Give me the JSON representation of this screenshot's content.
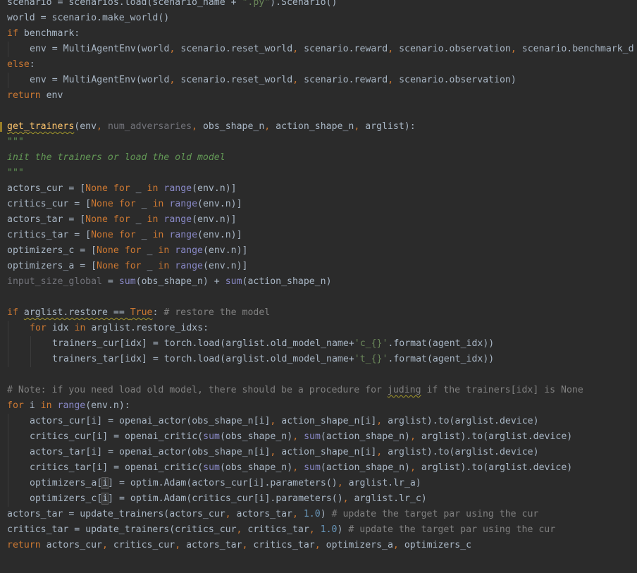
{
  "editor": {
    "colors": {
      "background": "#2b2b2b",
      "default_text": "#a9b7c6",
      "keyword": "#cc7832",
      "string": "#6a8759",
      "number": "#6897bb",
      "builtin": "#8888c6",
      "comment": "#808080",
      "docstring": "#629755",
      "parameter": "#aa4926",
      "unused": "#72737a",
      "warning_underline": "#a59a2a"
    },
    "lines": [
      {
        "indent": 1,
        "tokens": [
          {
            "t": "scenario = scenarios.load(scenario_name + ",
            "k": "n"
          },
          {
            "t": "\".py\"",
            "k": "s"
          },
          {
            "t": ").Scenario()",
            "k": "n"
          }
        ]
      },
      {
        "indent": 1,
        "tokens": [
          {
            "t": "world = scenario.make_world()",
            "k": "n"
          }
        ]
      },
      {
        "indent": 1,
        "tokens": [
          {
            "t": "if",
            "k": "k"
          },
          {
            "t": " benchmark:",
            "k": "n"
          }
        ]
      },
      {
        "indent": 2,
        "tokens": [
          {
            "t": "env = MultiAgentEnv(world",
            "k": "n"
          },
          {
            "t": ",",
            "k": "k"
          },
          {
            "t": " scenario.reset_world",
            "k": "n"
          },
          {
            "t": ",",
            "k": "k"
          },
          {
            "t": " scenario.reward",
            "k": "n"
          },
          {
            "t": ",",
            "k": "k"
          },
          {
            "t": " scenario.observation",
            "k": "n"
          },
          {
            "t": ",",
            "k": "k"
          },
          {
            "t": " scenario.benchmark_d",
            "k": "n"
          }
        ]
      },
      {
        "indent": 1,
        "tokens": [
          {
            "t": "else",
            "k": "k"
          },
          {
            "t": ":",
            "k": "n"
          }
        ]
      },
      {
        "indent": 2,
        "tokens": [
          {
            "t": "env = MultiAgentEnv(world",
            "k": "n"
          },
          {
            "t": ",",
            "k": "k"
          },
          {
            "t": " scenario.reset_world",
            "k": "n"
          },
          {
            "t": ",",
            "k": "k"
          },
          {
            "t": " scenario.reward",
            "k": "n"
          },
          {
            "t": ",",
            "k": "k"
          },
          {
            "t": " scenario.observation)",
            "k": "n"
          }
        ]
      },
      {
        "indent": 1,
        "tokens": [
          {
            "t": "return",
            "k": "k"
          },
          {
            "t": " env",
            "k": "n"
          }
        ]
      },
      {
        "indent": 0,
        "tokens": []
      },
      {
        "indent": 0,
        "mark": true,
        "tokens": [
          {
            "t": "get_trainers",
            "k": "f"
          },
          {
            "t": "(env",
            "k": "n"
          },
          {
            "t": ",",
            "k": "k"
          },
          {
            "t": " num_adversaries",
            "k": "u"
          },
          {
            "t": ",",
            "k": "k"
          },
          {
            "t": " obs_shape_n",
            "k": "n"
          },
          {
            "t": ",",
            "k": "k"
          },
          {
            "t": " action_shape_n",
            "k": "n"
          },
          {
            "t": ",",
            "k": "k"
          },
          {
            "t": " arglist):",
            "k": "n"
          }
        ]
      },
      {
        "indent": 1,
        "tokens": [
          {
            "t": "\"\"\"",
            "k": "d"
          }
        ]
      },
      {
        "indent": 1,
        "tokens": [
          {
            "t": "init the trainers or load the old model",
            "k": "d"
          }
        ]
      },
      {
        "indent": 1,
        "tokens": [
          {
            "t": "\"\"\"",
            "k": "d"
          }
        ]
      },
      {
        "indent": 1,
        "tokens": [
          {
            "t": "actors_cur = [",
            "k": "n"
          },
          {
            "t": "None",
            "k": "k"
          },
          {
            "t": " ",
            "k": "n"
          },
          {
            "t": "for",
            "k": "k"
          },
          {
            "t": " _ ",
            "k": "n"
          },
          {
            "t": "in",
            "k": "k"
          },
          {
            "t": " ",
            "k": "n"
          },
          {
            "t": "range",
            "k": "b"
          },
          {
            "t": "(env.n)]",
            "k": "n"
          }
        ]
      },
      {
        "indent": 1,
        "tokens": [
          {
            "t": "critics_cur = [",
            "k": "n"
          },
          {
            "t": "None",
            "k": "k"
          },
          {
            "t": " ",
            "k": "n"
          },
          {
            "t": "for",
            "k": "k"
          },
          {
            "t": " _ ",
            "k": "n"
          },
          {
            "t": "in",
            "k": "k"
          },
          {
            "t": " ",
            "k": "n"
          },
          {
            "t": "range",
            "k": "b"
          },
          {
            "t": "(env.n)]",
            "k": "n"
          }
        ]
      },
      {
        "indent": 1,
        "tokens": [
          {
            "t": "actors_tar = [",
            "k": "n"
          },
          {
            "t": "None",
            "k": "k"
          },
          {
            "t": " ",
            "k": "n"
          },
          {
            "t": "for",
            "k": "k"
          },
          {
            "t": " _ ",
            "k": "n"
          },
          {
            "t": "in",
            "k": "k"
          },
          {
            "t": " ",
            "k": "n"
          },
          {
            "t": "range",
            "k": "b"
          },
          {
            "t": "(env.n)]",
            "k": "n"
          }
        ]
      },
      {
        "indent": 1,
        "tokens": [
          {
            "t": "critics_tar = [",
            "k": "n"
          },
          {
            "t": "None",
            "k": "k"
          },
          {
            "t": " ",
            "k": "n"
          },
          {
            "t": "for",
            "k": "k"
          },
          {
            "t": " _ ",
            "k": "n"
          },
          {
            "t": "in",
            "k": "k"
          },
          {
            "t": " ",
            "k": "n"
          },
          {
            "t": "range",
            "k": "b"
          },
          {
            "t": "(env.n)]",
            "k": "n"
          }
        ]
      },
      {
        "indent": 1,
        "tokens": [
          {
            "t": "optimizers_c = [",
            "k": "n"
          },
          {
            "t": "None",
            "k": "k"
          },
          {
            "t": " ",
            "k": "n"
          },
          {
            "t": "for",
            "k": "k"
          },
          {
            "t": " _ ",
            "k": "n"
          },
          {
            "t": "in",
            "k": "k"
          },
          {
            "t": " ",
            "k": "n"
          },
          {
            "t": "range",
            "k": "b"
          },
          {
            "t": "(env.n)]",
            "k": "n"
          }
        ]
      },
      {
        "indent": 1,
        "tokens": [
          {
            "t": "optimizers_a = [",
            "k": "n"
          },
          {
            "t": "None",
            "k": "k"
          },
          {
            "t": " ",
            "k": "n"
          },
          {
            "t": "for",
            "k": "k"
          },
          {
            "t": " _ ",
            "k": "n"
          },
          {
            "t": "in",
            "k": "k"
          },
          {
            "t": " ",
            "k": "n"
          },
          {
            "t": "range",
            "k": "b"
          },
          {
            "t": "(env.n)]",
            "k": "n"
          }
        ]
      },
      {
        "indent": 1,
        "tokens": [
          {
            "t": "input_size_global",
            "k": "u"
          },
          {
            "t": " = ",
            "k": "n"
          },
          {
            "t": "sum",
            "k": "b"
          },
          {
            "t": "(obs_shape_n) + ",
            "k": "n"
          },
          {
            "t": "sum",
            "k": "b"
          },
          {
            "t": "(action_shape_n)",
            "k": "n"
          }
        ]
      },
      {
        "indent": 1,
        "tokens": []
      },
      {
        "indent": 1,
        "tokens": [
          {
            "t": "if",
            "k": "k"
          },
          {
            "t": " ",
            "k": "n"
          },
          {
            "t": "arglist.restore == ",
            "k": "nw"
          },
          {
            "t": "True",
            "k": "kw"
          },
          {
            "t": ":",
            "k": "n"
          },
          {
            "t": " # restore the model",
            "k": "c"
          }
        ]
      },
      {
        "indent": 2,
        "tokens": [
          {
            "t": "for",
            "k": "k"
          },
          {
            "t": " idx ",
            "k": "n"
          },
          {
            "t": "in",
            "k": "k"
          },
          {
            "t": " arglist.restore_idxs:",
            "k": "n"
          }
        ]
      },
      {
        "indent": 3,
        "tokens": [
          {
            "t": "trainers_cur[idx] = torch.load(arglist.old_model_name+",
            "k": "n"
          },
          {
            "t": "'c_{}'",
            "k": "s"
          },
          {
            "t": ".format(agent_idx))",
            "k": "n"
          }
        ]
      },
      {
        "indent": 3,
        "tokens": [
          {
            "t": "trainers_tar[idx] = torch.load(arglist.old_model_name+",
            "k": "n"
          },
          {
            "t": "'t_{}'",
            "k": "s"
          },
          {
            "t": ".format(agent_idx))",
            "k": "n"
          }
        ]
      },
      {
        "indent": 1,
        "tokens": []
      },
      {
        "indent": 1,
        "tokens": [
          {
            "t": "# Note: if you need load old model, there should be a procedure for ",
            "k": "c"
          },
          {
            "t": "juding",
            "k": "cw"
          },
          {
            "t": " if the trainers[idx] is None",
            "k": "c"
          }
        ]
      },
      {
        "indent": 1,
        "tokens": [
          {
            "t": "for",
            "k": "k"
          },
          {
            "t": " i ",
            "k": "n"
          },
          {
            "t": "in",
            "k": "k"
          },
          {
            "t": " ",
            "k": "n"
          },
          {
            "t": "range",
            "k": "b"
          },
          {
            "t": "(env.n):",
            "k": "n"
          }
        ]
      },
      {
        "indent": 2,
        "tokens": [
          {
            "t": "actors_cur[i] = openai_actor(obs_shape_n[i]",
            "k": "n"
          },
          {
            "t": ",",
            "k": "k"
          },
          {
            "t": " action_shape_n[i]",
            "k": "n"
          },
          {
            "t": ",",
            "k": "k"
          },
          {
            "t": " arglist).to(arglist.device)",
            "k": "n"
          }
        ]
      },
      {
        "indent": 2,
        "tokens": [
          {
            "t": "critics_cur[i] = openai_critic(",
            "k": "n"
          },
          {
            "t": "sum",
            "k": "b"
          },
          {
            "t": "(obs_shape_n)",
            "k": "n"
          },
          {
            "t": ",",
            "k": "k"
          },
          {
            "t": " ",
            "k": "n"
          },
          {
            "t": "sum",
            "k": "b"
          },
          {
            "t": "(action_shape_n)",
            "k": "n"
          },
          {
            "t": ",",
            "k": "k"
          },
          {
            "t": " arglist).to(arglist.device)",
            "k": "n"
          }
        ]
      },
      {
        "indent": 2,
        "tokens": [
          {
            "t": "actors_tar[i] = openai_actor(obs_shape_n[i]",
            "k": "n"
          },
          {
            "t": ",",
            "k": "k"
          },
          {
            "t": " action_shape_n[i]",
            "k": "n"
          },
          {
            "t": ",",
            "k": "k"
          },
          {
            "t": " arglist).to(arglist.device)",
            "k": "n"
          }
        ]
      },
      {
        "indent": 2,
        "tokens": [
          {
            "t": "critics_tar[i] = openai_critic(",
            "k": "n"
          },
          {
            "t": "sum",
            "k": "b"
          },
          {
            "t": "(obs_shape_n)",
            "k": "n"
          },
          {
            "t": ",",
            "k": "k"
          },
          {
            "t": " ",
            "k": "n"
          },
          {
            "t": "sum",
            "k": "b"
          },
          {
            "t": "(action_shape_n)",
            "k": "n"
          },
          {
            "t": ",",
            "k": "k"
          },
          {
            "t": " arglist).to(arglist.device)",
            "k": "n"
          }
        ]
      },
      {
        "indent": 2,
        "tokens": [
          {
            "t": "optimizers_a[",
            "k": "n"
          },
          {
            "t": "i",
            "k": "h"
          },
          {
            "t": "] = optim.Adam(actors_cur[i].parameters()",
            "k": "n"
          },
          {
            "t": ",",
            "k": "k"
          },
          {
            "t": " arglist.lr_a)",
            "k": "n"
          }
        ]
      },
      {
        "indent": 2,
        "tokens": [
          {
            "t": "optimizers_c[",
            "k": "n"
          },
          {
            "t": "i",
            "k": "h"
          },
          {
            "t": "] = optim.Adam(critics_cur[i].parameters()",
            "k": "n"
          },
          {
            "t": ",",
            "k": "k"
          },
          {
            "t": " arglist.lr_c)",
            "k": "n"
          }
        ]
      },
      {
        "indent": 1,
        "tokens": [
          {
            "t": "actors_tar = update_trainers(actors_cur",
            "k": "n"
          },
          {
            "t": ",",
            "k": "k"
          },
          {
            "t": " actors_tar",
            "k": "n"
          },
          {
            "t": ",",
            "k": "k"
          },
          {
            "t": " ",
            "k": "n"
          },
          {
            "t": "1.0",
            "k": "num"
          },
          {
            "t": ")",
            "k": "n"
          },
          {
            "t": " # update the target par using the cur",
            "k": "c"
          }
        ]
      },
      {
        "indent": 1,
        "tokens": [
          {
            "t": "critics_tar = update_trainers(critics_cur",
            "k": "n"
          },
          {
            "t": ",",
            "k": "k"
          },
          {
            "t": " critics_tar",
            "k": "n"
          },
          {
            "t": ",",
            "k": "k"
          },
          {
            "t": " ",
            "k": "n"
          },
          {
            "t": "1.0",
            "k": "num"
          },
          {
            "t": ")",
            "k": "n"
          },
          {
            "t": " # update the target par using the cur",
            "k": "c"
          }
        ]
      },
      {
        "indent": 1,
        "tokens": [
          {
            "t": "return",
            "k": "k"
          },
          {
            "t": " actors_cur",
            "k": "n"
          },
          {
            "t": ",",
            "k": "k"
          },
          {
            "t": " critics_cur",
            "k": "n"
          },
          {
            "t": ",",
            "k": "k"
          },
          {
            "t": " actors_tar",
            "k": "n"
          },
          {
            "t": ",",
            "k": "k"
          },
          {
            "t": " critics_tar",
            "k": "n"
          },
          {
            "t": ",",
            "k": "k"
          },
          {
            "t": " optimizers_a",
            "k": "n"
          },
          {
            "t": ",",
            "k": "k"
          },
          {
            "t": " optimizers_c",
            "k": "n"
          }
        ]
      }
    ]
  }
}
